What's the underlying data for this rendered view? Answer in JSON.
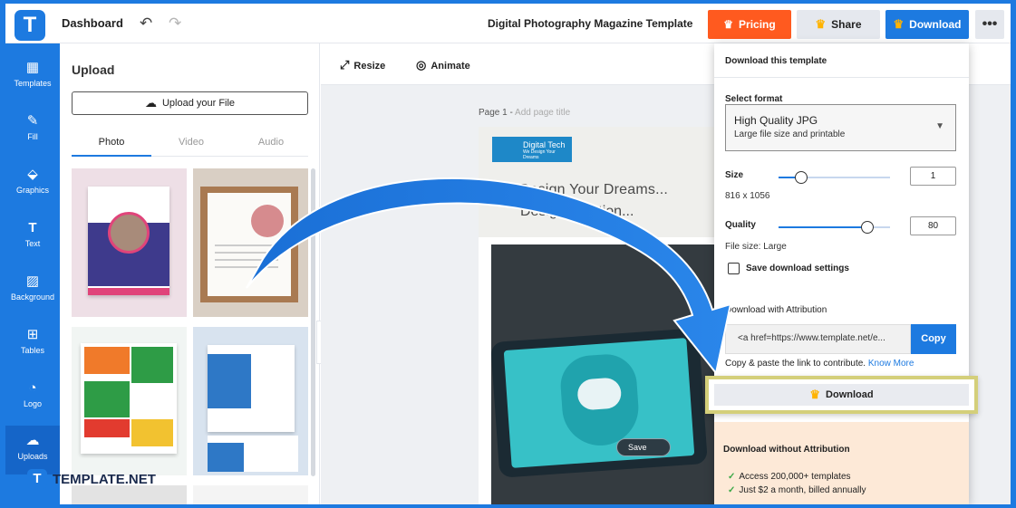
{
  "header": {
    "logo_letter": "T",
    "dashboard_label": "Dashboard",
    "undo_glyph": "↶",
    "redo_glyph": "↷",
    "title": "Digital Photography Magazine Template",
    "pricing_label": "Pricing",
    "share_label": "Share",
    "download_label": "Download",
    "more_glyph": "•••",
    "crown_glyph": "♛"
  },
  "sidebar": {
    "items": [
      {
        "label": "Templates",
        "icon": "▦"
      },
      {
        "label": "Fill",
        "icon": "✎"
      },
      {
        "label": "Graphics",
        "icon": "⬙"
      },
      {
        "label": "Text",
        "icon": "T"
      },
      {
        "label": "Background",
        "icon": "▨"
      },
      {
        "label": "Tables",
        "icon": "⊞"
      },
      {
        "label": "Logo",
        "icon": "◔"
      },
      {
        "label": "Uploads",
        "icon": "☁"
      }
    ]
  },
  "upload_panel": {
    "title": "Upload",
    "upload_button": "Upload your File",
    "upload_icon": "☁",
    "tabs": [
      "Photo",
      "Video",
      "Audio"
    ],
    "collapse_glyph": "‹"
  },
  "canvas": {
    "tools": [
      {
        "label": "Resize",
        "icon": "⤢"
      },
      {
        "label": "Animate",
        "icon": "◎"
      }
    ],
    "page_label": "Page 1 -",
    "page_placeholder": "Add page title",
    "magazine": {
      "brand": "Digital Tech",
      "brand_tagline": "We Design Your Dreams",
      "line1": "We Design Your Dreams...",
      "line2": "Design Solution...",
      "save_label": "Save"
    }
  },
  "download_panel": {
    "title": "Download this template",
    "select_format_label": "Select format",
    "format_main": "High Quality JPG",
    "format_sub": "Large file size and printable",
    "size_label": "Size",
    "size_value": "1",
    "size_dims": "816 x 1056",
    "size_level": 0.2,
    "quality_label": "Quality",
    "quality_value": "80",
    "quality_level": 0.8,
    "file_size": "File size: Large",
    "save_settings_label": "Save download settings",
    "attribution_label": "Download with Attribution",
    "attribution_link": "<a href=https://www.template.net/e...",
    "copy_label": "Copy",
    "copy_note": "Copy & paste the link to contribute.",
    "know_more": "Know More",
    "download_button": "Download",
    "no_attribution_title": "Download without Attribution",
    "features": [
      "Access 200,000+ templates",
      "Just $2 a month, billed annually"
    ]
  },
  "watermark": {
    "logo_letter": "T",
    "text": "TEMPLATE.NET"
  },
  "colors": {
    "brand": "#1d7ae0",
    "pricing": "#ff5a1f",
    "highlight": "#d4cf7a"
  }
}
